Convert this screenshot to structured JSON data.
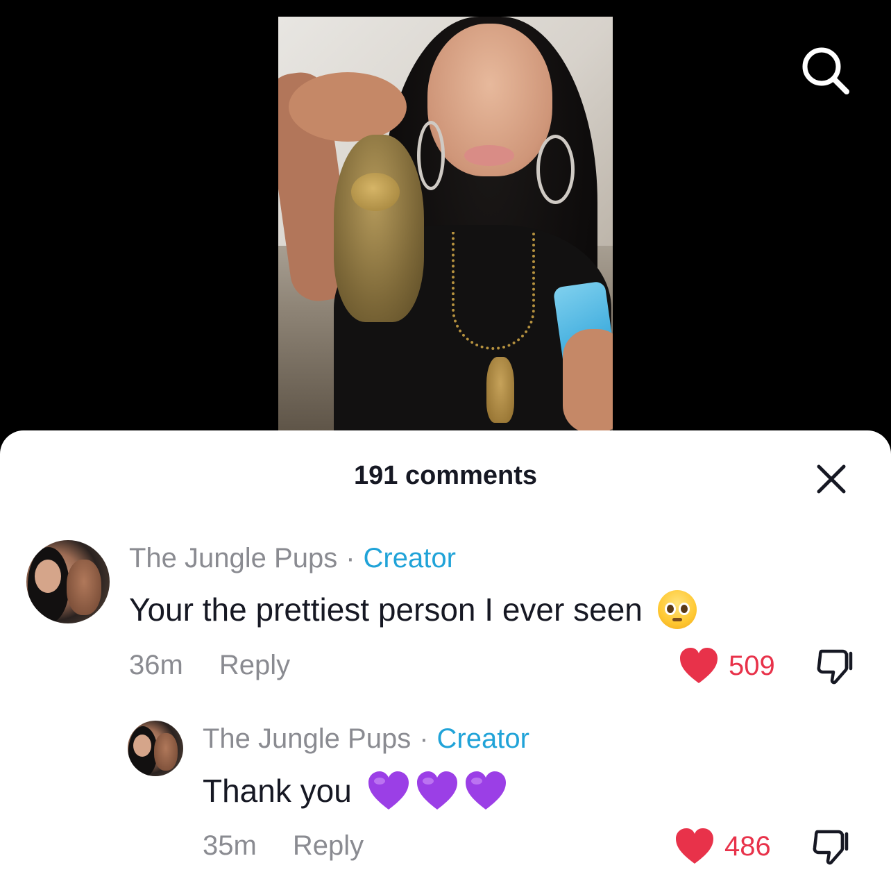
{
  "sheet": {
    "title": "191 comments"
  },
  "comments": [
    {
      "author": "The Jungle Pups",
      "separator": "·",
      "badge": "Creator",
      "text": "Your the prettiest person I ever seen",
      "emoji": "pleading-face",
      "time": "36m",
      "reply_label": "Reply",
      "likes": "509",
      "liked": true
    },
    {
      "author": "The Jungle Pups",
      "separator": "·",
      "badge": "Creator",
      "text": "Thank you",
      "emoji": "purple-heart x3",
      "time": "35m",
      "reply_label": "Reply",
      "likes": "486",
      "liked": true
    }
  ],
  "colors": {
    "like": "#e8324a",
    "creator_badge": "#20a3d8",
    "purple_heart": "#9b3fe6",
    "text_primary": "#161823",
    "text_secondary": "#8a8b91"
  }
}
